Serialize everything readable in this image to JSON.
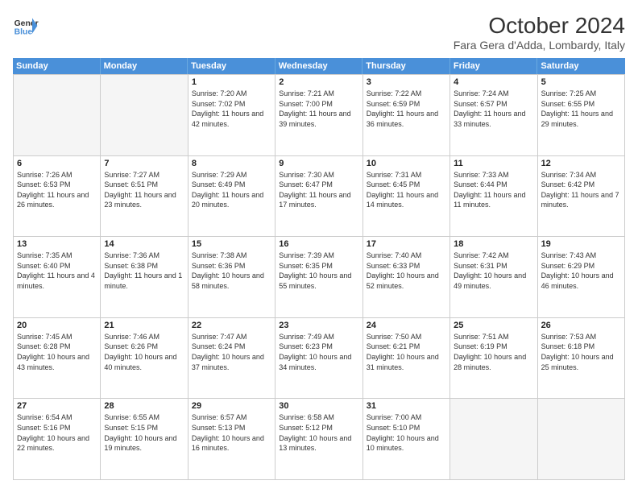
{
  "header": {
    "logo_general": "General",
    "logo_blue": "Blue",
    "month_title": "October 2024",
    "subtitle": "Fara Gera d'Adda, Lombardy, Italy"
  },
  "weekdays": [
    "Sunday",
    "Monday",
    "Tuesday",
    "Wednesday",
    "Thursday",
    "Friday",
    "Saturday"
  ],
  "weeks": [
    [
      {
        "day": "",
        "empty": true
      },
      {
        "day": "",
        "empty": true
      },
      {
        "day": "1",
        "sunrise": "Sunrise: 7:20 AM",
        "sunset": "Sunset: 7:02 PM",
        "daylight": "Daylight: 11 hours and 42 minutes."
      },
      {
        "day": "2",
        "sunrise": "Sunrise: 7:21 AM",
        "sunset": "Sunset: 7:00 PM",
        "daylight": "Daylight: 11 hours and 39 minutes."
      },
      {
        "day": "3",
        "sunrise": "Sunrise: 7:22 AM",
        "sunset": "Sunset: 6:59 PM",
        "daylight": "Daylight: 11 hours and 36 minutes."
      },
      {
        "day": "4",
        "sunrise": "Sunrise: 7:24 AM",
        "sunset": "Sunset: 6:57 PM",
        "daylight": "Daylight: 11 hours and 33 minutes."
      },
      {
        "day": "5",
        "sunrise": "Sunrise: 7:25 AM",
        "sunset": "Sunset: 6:55 PM",
        "daylight": "Daylight: 11 hours and 29 minutes."
      }
    ],
    [
      {
        "day": "6",
        "sunrise": "Sunrise: 7:26 AM",
        "sunset": "Sunset: 6:53 PM",
        "daylight": "Daylight: 11 hours and 26 minutes."
      },
      {
        "day": "7",
        "sunrise": "Sunrise: 7:27 AM",
        "sunset": "Sunset: 6:51 PM",
        "daylight": "Daylight: 11 hours and 23 minutes."
      },
      {
        "day": "8",
        "sunrise": "Sunrise: 7:29 AM",
        "sunset": "Sunset: 6:49 PM",
        "daylight": "Daylight: 11 hours and 20 minutes."
      },
      {
        "day": "9",
        "sunrise": "Sunrise: 7:30 AM",
        "sunset": "Sunset: 6:47 PM",
        "daylight": "Daylight: 11 hours and 17 minutes."
      },
      {
        "day": "10",
        "sunrise": "Sunrise: 7:31 AM",
        "sunset": "Sunset: 6:45 PM",
        "daylight": "Daylight: 11 hours and 14 minutes."
      },
      {
        "day": "11",
        "sunrise": "Sunrise: 7:33 AM",
        "sunset": "Sunset: 6:44 PM",
        "daylight": "Daylight: 11 hours and 11 minutes."
      },
      {
        "day": "12",
        "sunrise": "Sunrise: 7:34 AM",
        "sunset": "Sunset: 6:42 PM",
        "daylight": "Daylight: 11 hours and 7 minutes."
      }
    ],
    [
      {
        "day": "13",
        "sunrise": "Sunrise: 7:35 AM",
        "sunset": "Sunset: 6:40 PM",
        "daylight": "Daylight: 11 hours and 4 minutes."
      },
      {
        "day": "14",
        "sunrise": "Sunrise: 7:36 AM",
        "sunset": "Sunset: 6:38 PM",
        "daylight": "Daylight: 11 hours and 1 minute."
      },
      {
        "day": "15",
        "sunrise": "Sunrise: 7:38 AM",
        "sunset": "Sunset: 6:36 PM",
        "daylight": "Daylight: 10 hours and 58 minutes."
      },
      {
        "day": "16",
        "sunrise": "Sunrise: 7:39 AM",
        "sunset": "Sunset: 6:35 PM",
        "daylight": "Daylight: 10 hours and 55 minutes."
      },
      {
        "day": "17",
        "sunrise": "Sunrise: 7:40 AM",
        "sunset": "Sunset: 6:33 PM",
        "daylight": "Daylight: 10 hours and 52 minutes."
      },
      {
        "day": "18",
        "sunrise": "Sunrise: 7:42 AM",
        "sunset": "Sunset: 6:31 PM",
        "daylight": "Daylight: 10 hours and 49 minutes."
      },
      {
        "day": "19",
        "sunrise": "Sunrise: 7:43 AM",
        "sunset": "Sunset: 6:29 PM",
        "daylight": "Daylight: 10 hours and 46 minutes."
      }
    ],
    [
      {
        "day": "20",
        "sunrise": "Sunrise: 7:45 AM",
        "sunset": "Sunset: 6:28 PM",
        "daylight": "Daylight: 10 hours and 43 minutes."
      },
      {
        "day": "21",
        "sunrise": "Sunrise: 7:46 AM",
        "sunset": "Sunset: 6:26 PM",
        "daylight": "Daylight: 10 hours and 40 minutes."
      },
      {
        "day": "22",
        "sunrise": "Sunrise: 7:47 AM",
        "sunset": "Sunset: 6:24 PM",
        "daylight": "Daylight: 10 hours and 37 minutes."
      },
      {
        "day": "23",
        "sunrise": "Sunrise: 7:49 AM",
        "sunset": "Sunset: 6:23 PM",
        "daylight": "Daylight: 10 hours and 34 minutes."
      },
      {
        "day": "24",
        "sunrise": "Sunrise: 7:50 AM",
        "sunset": "Sunset: 6:21 PM",
        "daylight": "Daylight: 10 hours and 31 minutes."
      },
      {
        "day": "25",
        "sunrise": "Sunrise: 7:51 AM",
        "sunset": "Sunset: 6:19 PM",
        "daylight": "Daylight: 10 hours and 28 minutes."
      },
      {
        "day": "26",
        "sunrise": "Sunrise: 7:53 AM",
        "sunset": "Sunset: 6:18 PM",
        "daylight": "Daylight: 10 hours and 25 minutes."
      }
    ],
    [
      {
        "day": "27",
        "sunrise": "Sunrise: 6:54 AM",
        "sunset": "Sunset: 5:16 PM",
        "daylight": "Daylight: 10 hours and 22 minutes."
      },
      {
        "day": "28",
        "sunrise": "Sunrise: 6:55 AM",
        "sunset": "Sunset: 5:15 PM",
        "daylight": "Daylight: 10 hours and 19 minutes."
      },
      {
        "day": "29",
        "sunrise": "Sunrise: 6:57 AM",
        "sunset": "Sunset: 5:13 PM",
        "daylight": "Daylight: 10 hours and 16 minutes."
      },
      {
        "day": "30",
        "sunrise": "Sunrise: 6:58 AM",
        "sunset": "Sunset: 5:12 PM",
        "daylight": "Daylight: 10 hours and 13 minutes."
      },
      {
        "day": "31",
        "sunrise": "Sunrise: 7:00 AM",
        "sunset": "Sunset: 5:10 PM",
        "daylight": "Daylight: 10 hours and 10 minutes."
      },
      {
        "day": "",
        "empty": true
      },
      {
        "day": "",
        "empty": true
      }
    ]
  ]
}
